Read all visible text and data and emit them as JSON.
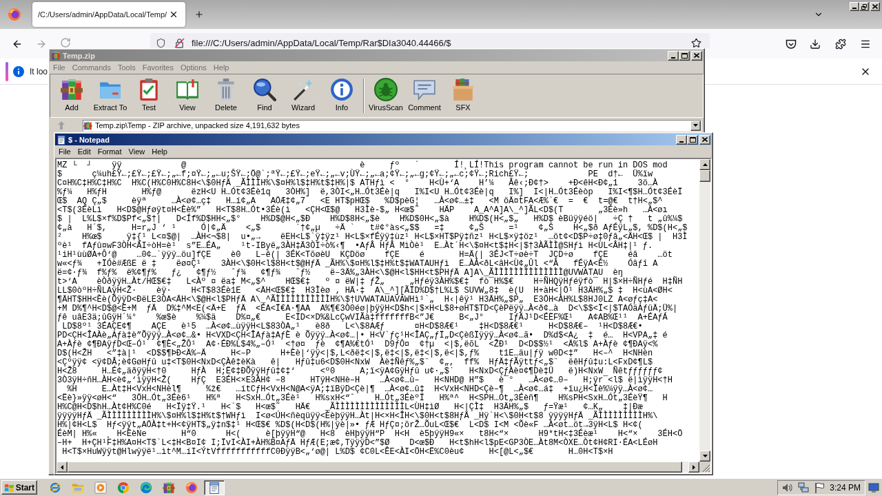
{
  "browser": {
    "tabs": [
      {
        "title": "/C:/Users/admin/AppData/Local/Temp/",
        "selected": true
      }
    ],
    "address": "file:///C:/Users/admin/AppData/Local/Temp/Rar$DIa3040.44466/$",
    "notification": "It loo"
  },
  "archive_window": {
    "title": "Temp.zip",
    "active": false,
    "menu": [
      "File",
      "Commands",
      "Tools",
      "Favorites",
      "Options",
      "Help"
    ],
    "toolbar_groups": [
      {
        "buttons": [
          {
            "kind": "add",
            "label": "Add"
          },
          {
            "kind": "extract",
            "label": "Extract To"
          },
          {
            "kind": "test",
            "label": "Test"
          },
          {
            "kind": "view",
            "label": "View"
          },
          {
            "kind": "delete",
            "label": "Delete"
          },
          {
            "kind": "find",
            "label": "Find"
          },
          {
            "kind": "wizard",
            "label": "Wizard"
          },
          {
            "kind": "info",
            "label": "Info"
          }
        ]
      },
      {
        "buttons": [
          {
            "kind": "virusscan",
            "label": "VirusScan"
          },
          {
            "kind": "comment",
            "label": "Comment"
          },
          {
            "kind": "sfx",
            "label": "SFX"
          }
        ]
      }
    ],
    "path": "Temp.zip\\Temp - ZIP archive, unpacked size 4,191,632 bytes"
  },
  "notepad": {
    "title": "$ - Notepad",
    "active": true,
    "menu": [
      "File",
      "Edit",
      "Format",
      "View",
      "Help"
    ],
    "lines": [
      "MZ └  ┘    ÿÿ            @                                   è     ƒº   ´       Í!¸LÍ!This program cannot be run in DOS mod",
      "$      ç¼uh£Ÿ←;£Ÿ←;£Ÿ←;„←f;¤Ÿ←;„←u;ŠŸ←;Ö@`;ªŸ←;£Ÿ←;eŸ←;„←v;ÙŸ←;„←a;¢Ÿ←;„←g;¢Ÿ←;„←c;¢Ÿ←;Rich£Ÿ←;            PE  d†←  Ü%ïw",
      "C¤H%C‡H%C‡H%C  H%C(H%C0H%C8H<\\$0HƒÄ _ÃÌÌÌH%\\$¤H%l$‡H%t$‡H%|$ ATHƒì <  °    H<Ù+‘A    H’¼   Âê‹;Ð¢†>    +Ð<êH<Ð¢„1    3ö…À",
      "%ƒ¼   H%ƒH       H%ƒ@      ëzH<U H…Ót¢3Éè1q   3ÒH%]  ë,3ÒI<„H…Ót3Éè|q   I%I<U H…Ót¢3Éè|q   I%]  I<|H…Ót3Éèòp   I%I<¶$H…Ót¢3ÉèÏ",
      "Œ$  AQ Ç„$     èÿª     …À<ø¢…ç‡   H…í¢„A   AÖÆ‡¢„7   <E HT$pHŒ$   %D$pèG¦   …À<ø¢…±‡   <M öÄ¤tFA<Æ%`€  =  €  t=@€  t†H<„$^",
      "<T$(3ÉèLì   H<D$@Hƒøÿt¤H<Èè%”   H<T$8H…Ót•3Éè(ì   <ÇH<Œ$@   H3Ìè-$„ H<œ$˜    HÄP    A_A^A]A\\_^]ÃL<D$(T       „3Éè»h   …À<øı",
      "$ |  L%L$×f%D$Pf<„$†|   D<Íf%D$HH<„$°    H%D$@H<„$Ð    H%D$8H<„$è    H%D$0H<„$à    H%D$(H<„$„   H%D$ èBüÿÿéö|   ÷Ç †   t „û%¼$",
      "¢„à   H´$,     H=r„J ‘ ¹     Ó|¢„Ä    <„$       ˙†¢„µ   ÷Ä `   t#¢°às<„$$   =‡     ¢„Š     =¹    ¢„Š    H<„$ð AƒÉÿL„$, %D$(H<„$",
      "²    H%œ$     ÿ‡{¹ L<¤$@|  …ÀH<¬$8|  u•„→    ëEH<L$`ÿ‡ÿz¹ H<L$×fÉÿÿ‡ùz¹ H<L$×HT$Pÿ‡ñz¹ H<L$×ÿ‡öz¹  …öt¢<D$P÷ø‡0ƒâ„<ÄH<Œ$ |  H3Ì",
      "ºè¹  fAƒû¤wF3ÒH<ÄI÷òH=è¹  s”E…ÉA„    ¹t-IByë„3ÀH‡Ä3ÒI÷ò%‹¶  •AƒÂ HƒÂ MìÒè¹  E…Àt´H<\\$¤H<t$‡H<|$†3ÀÃÌÌ@SHƒì H<ÙL<ÂH‡|¹ ƒ.",
      "¹iH¹ùùØA+Ô‘@    …0¢…`ÿÿÿ…öu]fÇE    è0   L–ê(| 3ÉK<TõøèU  KÇDöø    fÇE    é       H=Ä(| 3ÉJ<T÷øè÷T  JÇD÷ø    fÇE    éâ    …öt",
      "w«<ƒ¾   +ÏÓè#ÆßE ë ‡    ëø¤Ç¹    3ÀH<\\$0H<l$8H<t$@HƒÄ _ÃH%\\$¤H%l$‡H%t$‡WATAUHƒì  E…ÀÀ<ðL<âH<Ù¢„Ûl <“À   fÉÿA<È½    Óâƒî A",
      "ë=¢·ƒ¾  f%ƒ%  ë%¢¶ƒ%   ƒ¿   ¢¶ƒ½   ˆƒ¾   ¢¶ƒ¾   ˆƒ½    ë–3Ä%„3ÀH<\\$@H<l$HH<t$PHƒÄ A]A\\_ÃÌÌÌÌÌÌÌÌÌÌÌÌÌÌ@UVWATAU  èŋ",
      "t>‘A    èÒðÿÿH…Àt/HŒ$€‡   L<Àº ¤ ëa‡ M<„$^    HŒ$€‡   º ¤ ëW|‡ ƒŽ„     „Hƒéÿ3ÀH%$€‡  fò¯H%$€    H÷ÑHQÿHƒéÿfò¯ H|$×H÷ÑHƒé  H‡ÑH",
      "LL$0òºH÷ÑLAÿH<Ž·    èÿ·    H<T$83Éè1E   <ÄH<Œ$€‡  H3Ìèø ‚ HÄ·‡  A\\_^][ÃÏD%D$†L%L$ SUVW„8‡  è(U  H+àH<|Ö¹ H3ÄH%„$ ‡  H<ùA<ØH<",
      "¶ÄHT$HH<Èè(ÕÿÿD<ÐëLE3ÒA<ÄH<\\$@H<l$PHƒÄ A\\_^ÃÌÌÌÌÌÌÌÌÌÌÌH%\\$†UVWATAUAVAWHì¹`„  H‹|êÿ¹ H3ÄH%„$P„  E3ÖH<ÀH%L$8HJ0LZ A<øƒç‡A<",
      "+M D%¶^H<D$@<Ë+M  ƒÄ  D%‡^M<E(<Ä+E  ƒÄ  <ÉA<Ï€A·¶AA  A%¶€3Ò0éø|þÿÿH<D$h<|$×H<L$8+øHT$TD<ÇèPëÿÿ…À<ð¢…à  D<\\$$<Ï<|$TAÓäAƒüÄ;Ü%|",
      "ƒê uâE3ä;ûGÿH´¼°    %œ$è    %¼$ä    D%¤„€     E<ÏD<×D%&LcÇwVIÃà‡fffffffB<”J€     B<„J°     IƒÄJ¹D<ÉËF%Œ¹   A¢AB%Œ¹¹  A+ÉAƒÁ",
      " LD$8º¹ 3ÉAÇE¢¶    AÇE   è¹5  …À<ø¢…ùÿÿH<L$83ÒA„¹   è8ð   L<\\$8AÆƒ      ¤H<D$8Æ€¹    ‡H<D$8Æ€¹     H<D$8Æ€–  ¹H<D$8Æ€•",
      "PD<ÇH<ÎAÀè„Aƒà‡è”Õÿÿÿ…À<ø¢…&• H<VXD<ÇH<ÎAƒà‡AƒÈ è Õÿÿÿ…À<ø¢…|• H<V`ƒç¹H<ÎAÇ„ƒÏ„D<ÇèßÏÿÿÿ…À<ø¢…ã•  D%d$<A¿  ‡  é…  H<VPA„‡ é",
      "A+Àƒè ¢¶ÐAÿƒD<Œ–Ó¹  ¢¶È<„ŽÔ¹  A¢·ÉÐ%L$4%„–Ó¹  <†ø¤  ƒè  ¢¶A%€tÓ¹  D9ƒÔ¤  ¢†µ  <|$,ëõL  <ŽÐ¹  D<D$$½¹  <Ä%l$ A+Àƒè ¢¶ÐAÿ<%",
      "D$(H<ŽH   <”‡à|¹  <D$$¶ÞÐ<Ä%–Ä     H<–P      H+Èè|‘ÿÿ<|$,L<ðë‡<|$,ë‡<|$,ë‡<|$,ë<|$,ƒ%    t1E…äu|ƒÿ w0D<‡”   H<–^  H<NHèn",
      "<Çºÿÿ¢ <ÿ¢DÂ;è¢GøHƒû u‡<T$0H<NxD<ÇÀê‡èKà   ê|   Hƒû‡u6<D$0H<NxW  Àè‡Ñêƒ%„$¨  ¢„,  ff%  HƒÄ‡ƒÃÿttƒ<„$¨  ëêHƒû‡u:L<FxD¢¶L$",
      "H<Ž8     H…É¢„äðÿÿH<†0     HƒÀ  H;Ë¢‡ÐÕÿÿHƒû‡¢‡‘     <º0     A;ï<ÿA¢GÿHƒû u¢·„$˙   H<NxD<ÇƒÀè¤¢¶Dè‡Ü   ë)H<NxW  Ñêtƒƒƒƒƒƒ¢",
      "3Ò3ÿH÷ñH…ÀH<è¢„‘ìÿÿH<Ž(    HƒÇ  E3ÉH<×E3ÀH¢ –8     HTÿH<NHè–H    …À<ø¢…û–   H<NHD@ H”$   è¯°   …À<ø¢…0–   H;ÿr¯<l$ ë|ìÿÿH<†H",
      "  %H     E…Àt‡H<VxH<NHèl¶     %ž€   …ítCƒH<VxH<N@A<ÿA;‡ïBÿD<Çè|¶  …À<ø¢…û‡  H<VxH<NHD<Çè–¶  …À<ø¢…á‡  +ïu¿H<Ïè%¼ÿÿ…À<ø¢…",
      "<Ëè}»ÿÿ<øH<“   3ÖH…Ót„3Éè6¹   H%ª   H<SxH…Ót„3Éè¹   H%sxH<“ˆ    H…Ót„3ÉèºÏ   H%ª^  H<SPH…Ót„3Éèñ¶    H%sPH<SxH…Ót„3ÉèŸ¶   H",
      "H%C@H<D$hH…Àt¢H%C0é   H<Ïÿ‡Ÿ.¹   H<´$   H<œ$˜   HÄ€   _ÃÌÌÌÌÌÌÌÌÌÌÌÌÌÌL<ÙH‡ìØ   H<|ÇÌ‡  H3ÄH%„$   ƒ=Ÿæ¹   ¢…K„    ‡|Ðæ",
      "ÿÿÿÿHƒÄ _ÃÌÌÌÌÌÌÌÌÌH%\\$¤H%l$‡H%t$†WHƒì  I<ø<ÚH<ñèqüÿÿ<ÈèþÿÿH…Àt|H<×H<ÎH<\\$0H<t$8HƒÄ _Hÿ`H<\\$0H<t$8 ÿÿÿÿHƒÄ _ÃÌÌÌÌÌÌÌÌÌH%\\",
      "H%|¢H<L$  Hƒ<ÿÿt„AÖÀ‡t+H<¢ÿHT$„ÿ‡n$‡¹ H<Œ$€ %D$(H<D$(H%|ÿè|»• ƒÆ HƒÇ¤;õrŽ…ÕuL<Œ$€  L<D$ I<M <Õè«F …À<øt…öt→3ÿH<L$ H<¢(",
      "ÉèM| H%«  ¸ H<ËèNe       H“0      H<(     è[þÿÿH“@   H<8  èHþÿÿH“P  H<H  è5þÿÿH9«×   t8H<“×      H9*tH<‡3Éèæ¹    H<“×    3ÉH<Ö",
      "–H+  H+ÇH¹F‡H%A¤H<T$`L<‡H<B¤I¢ I;ÏvI<ÀI+ÀH%B¤AƒÄ HƒÆ(E;æ¢,TÿÿÿD<”$Ø    D<œ$Ð   H<t$hH<l$pE<GP3ÒE…Àt8M<ÒXE…Òt¢H¢RI·ÉA<LÉøH",
      " H<T$×HuWÿÿt@Hlwÿÿë¹…ìt^M…íI<ÝtVfffffffffffC0ÐÿÿB<„‘ø@| L%D$ ¢C0L<ÊE<ÀI<ÖH<Ë%C0èu¢     H<[@L<„$€       H…0H<T$×H"
    ]
  },
  "taskbar": {
    "start": "Start",
    "apps": [
      {
        "kind": "ie",
        "selected": false
      },
      {
        "kind": "explorer",
        "selected": false
      },
      {
        "kind": "media",
        "selected": false
      },
      {
        "kind": "chrome",
        "selected": false
      },
      {
        "kind": "edge",
        "selected": false
      },
      {
        "kind": "archiver",
        "selected": false
      },
      {
        "kind": "firefox",
        "selected": false
      },
      {
        "kind": "notepad",
        "selected": true
      }
    ],
    "clock": "3:24 PM"
  }
}
